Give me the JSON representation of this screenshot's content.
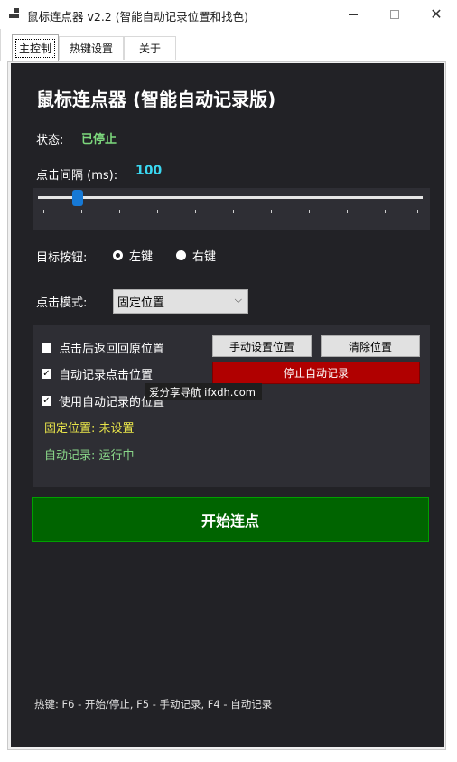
{
  "window": {
    "title": "鼠标连点器 v2.2 (智能自动记录位置和找色)",
    "minimize_glyph": "—",
    "close_glyph": "✕"
  },
  "tabs": [
    {
      "label": "主控制",
      "active": true
    },
    {
      "label": "热键设置",
      "active": false
    },
    {
      "label": "关于",
      "active": false
    }
  ],
  "main": {
    "heading": "鼠标连点器 (智能自动记录版)",
    "status_label": "状态:",
    "status_value": "已停止",
    "interval_label": "点击间隔 (ms):",
    "interval_value": "100",
    "target_button_label": "目标按钮:",
    "radio_left": "左键",
    "radio_right": "右键",
    "click_mode_label": "点击模式:",
    "click_mode_value": "固定位置",
    "options": {
      "return_original": "点击后返回回原位置",
      "auto_record": "自动记录点击位置",
      "use_auto_record": "使用自动记录的位置",
      "set_position_button": "手动设置位置",
      "clear_position_button": "清除位置",
      "stop_auto_record_button": "停止自动记录",
      "fixed_position_status": "固定位置: 未设置",
      "auto_record_status": "自动记录: 运行中"
    },
    "start_button": "开始连点",
    "hotkey_hint": "热键: F6 - 开始/停止, F5 - 手动记录, F4 - 自动记录"
  },
  "tooltip": "爱分享导航 ifxdh.com",
  "colors": {
    "panel_bg": "#222226",
    "status_green": "#7dd87d",
    "interval_cyan": "#3ad7f0",
    "stop_red": "#b00000",
    "start_green": "#006400",
    "fixed_yellow": "#e8e44a"
  }
}
